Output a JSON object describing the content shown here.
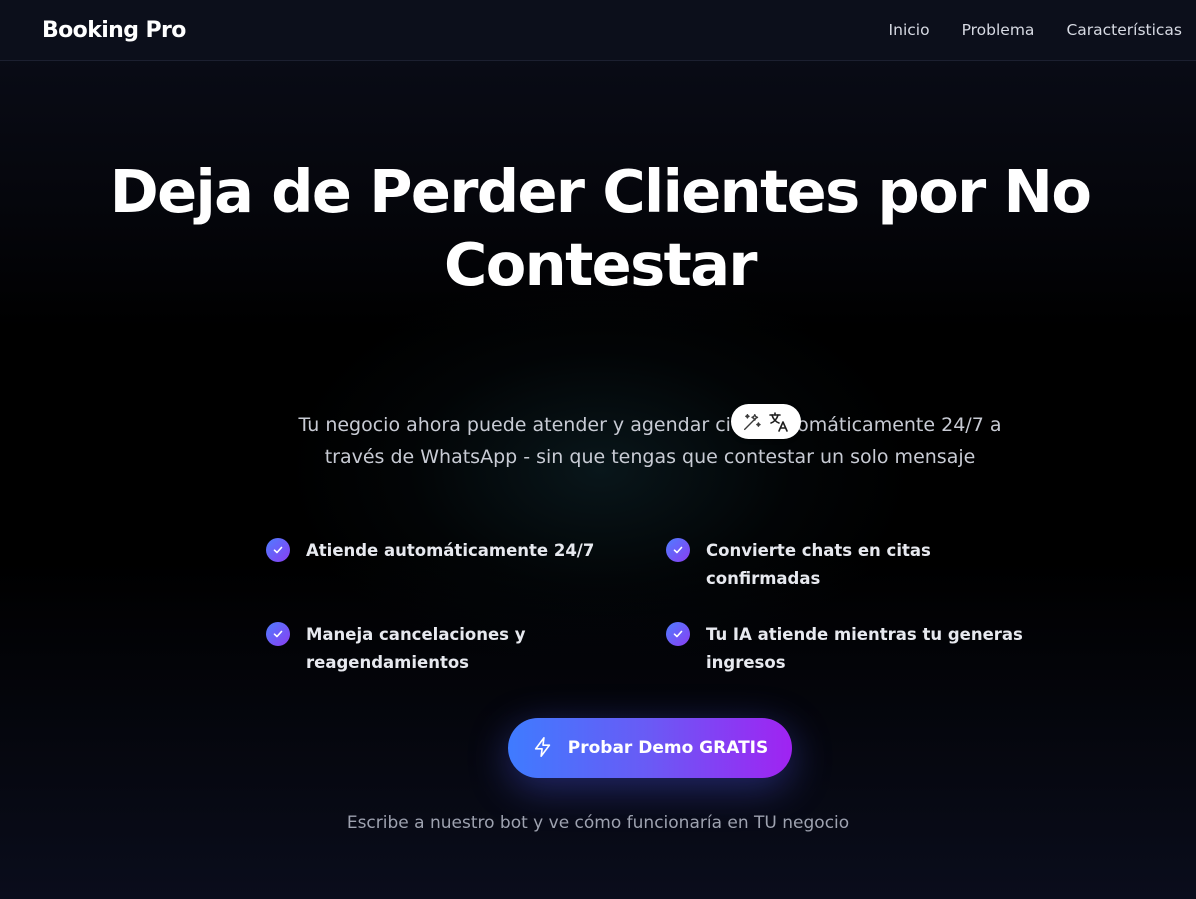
{
  "navbar": {
    "brand": "Booking Pro",
    "links": [
      {
        "label": "Inicio"
      },
      {
        "label": "Problema"
      },
      {
        "label": "Características"
      }
    ]
  },
  "hero": {
    "title_line1": "Deja de Perder Clientes por No",
    "title_line2": "Contestar",
    "subtitle": "Tu negocio ahora puede atender y agendar citas automáticamente 24/7 a través de WhatsApp - sin que tengas que contestar un solo mensaje"
  },
  "features": [
    {
      "text": "Atiende automáticamente 24/7"
    },
    {
      "text": "Convierte chats en citas confirmadas"
    },
    {
      "text": "Maneja cancelaciones y reagendamientos"
    },
    {
      "text": "Tu IA atiende mientras tu generas ingresos"
    }
  ],
  "cta": {
    "label": "Probar Demo GRATIS",
    "icon": "lightning-icon",
    "caption": "Escribe a nuestro bot y ve cómo funcionaría en TU negocio"
  },
  "overlay": {
    "icons": [
      "magic-wand-icon",
      "translate-icon"
    ]
  },
  "colors": {
    "background": "#000000",
    "navbar": "#0c0f1b",
    "accent_start": "#3f7bff",
    "accent_end": "#a023f2",
    "check_gradient_start": "#4f7dff",
    "check_gradient_end": "#8a3df2"
  }
}
